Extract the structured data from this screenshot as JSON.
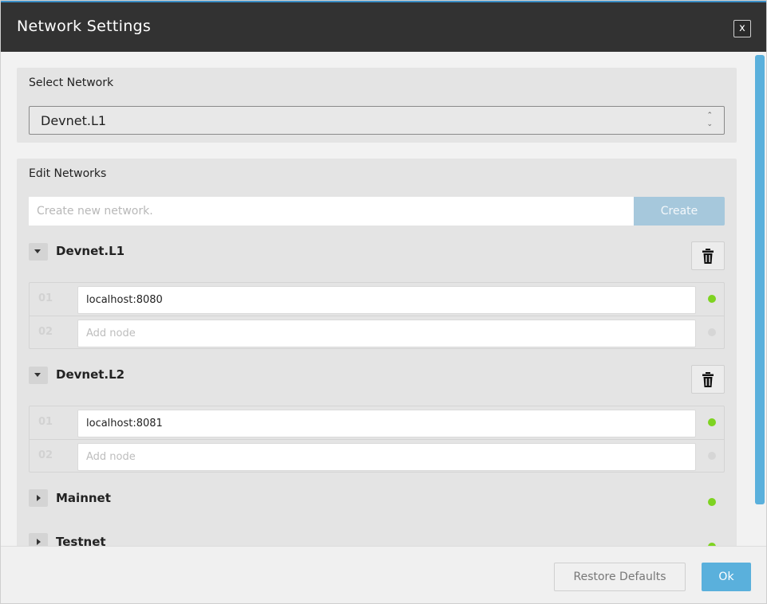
{
  "dialog": {
    "title": "Network Settings",
    "close_label": "x"
  },
  "select_network": {
    "heading": "Select Network",
    "selected": "Devnet.L1"
  },
  "edit_networks": {
    "heading": "Edit Networks",
    "create_placeholder": "Create new network.",
    "create_label": "Create",
    "networks": [
      {
        "name": "Devnet.L1",
        "expanded": true,
        "nodes": [
          {
            "num": "01",
            "value": "localhost:8080",
            "status": "online",
            "status_color": "#7ed321"
          },
          {
            "num": "02",
            "value": "",
            "placeholder": "Add node",
            "status": "none",
            "status_color": "#d6d6d6"
          }
        ]
      },
      {
        "name": "Devnet.L2",
        "expanded": true,
        "nodes": [
          {
            "num": "01",
            "value": "localhost:8081",
            "status": "online",
            "status_color": "#7ed321"
          },
          {
            "num": "02",
            "value": "",
            "placeholder": "Add node",
            "status": "none",
            "status_color": "#d6d6d6"
          }
        ]
      },
      {
        "name": "Mainnet",
        "expanded": false,
        "status": "online",
        "status_color": "#7ed321"
      },
      {
        "name": "Testnet",
        "expanded": false,
        "status": "online",
        "status_color": "#7ed321"
      }
    ]
  },
  "footer": {
    "restore_label": "Restore Defaults",
    "ok_label": "Ok"
  },
  "colors": {
    "accent": "#5ab0dc",
    "titlebar": "#323232",
    "online": "#7ed321"
  }
}
